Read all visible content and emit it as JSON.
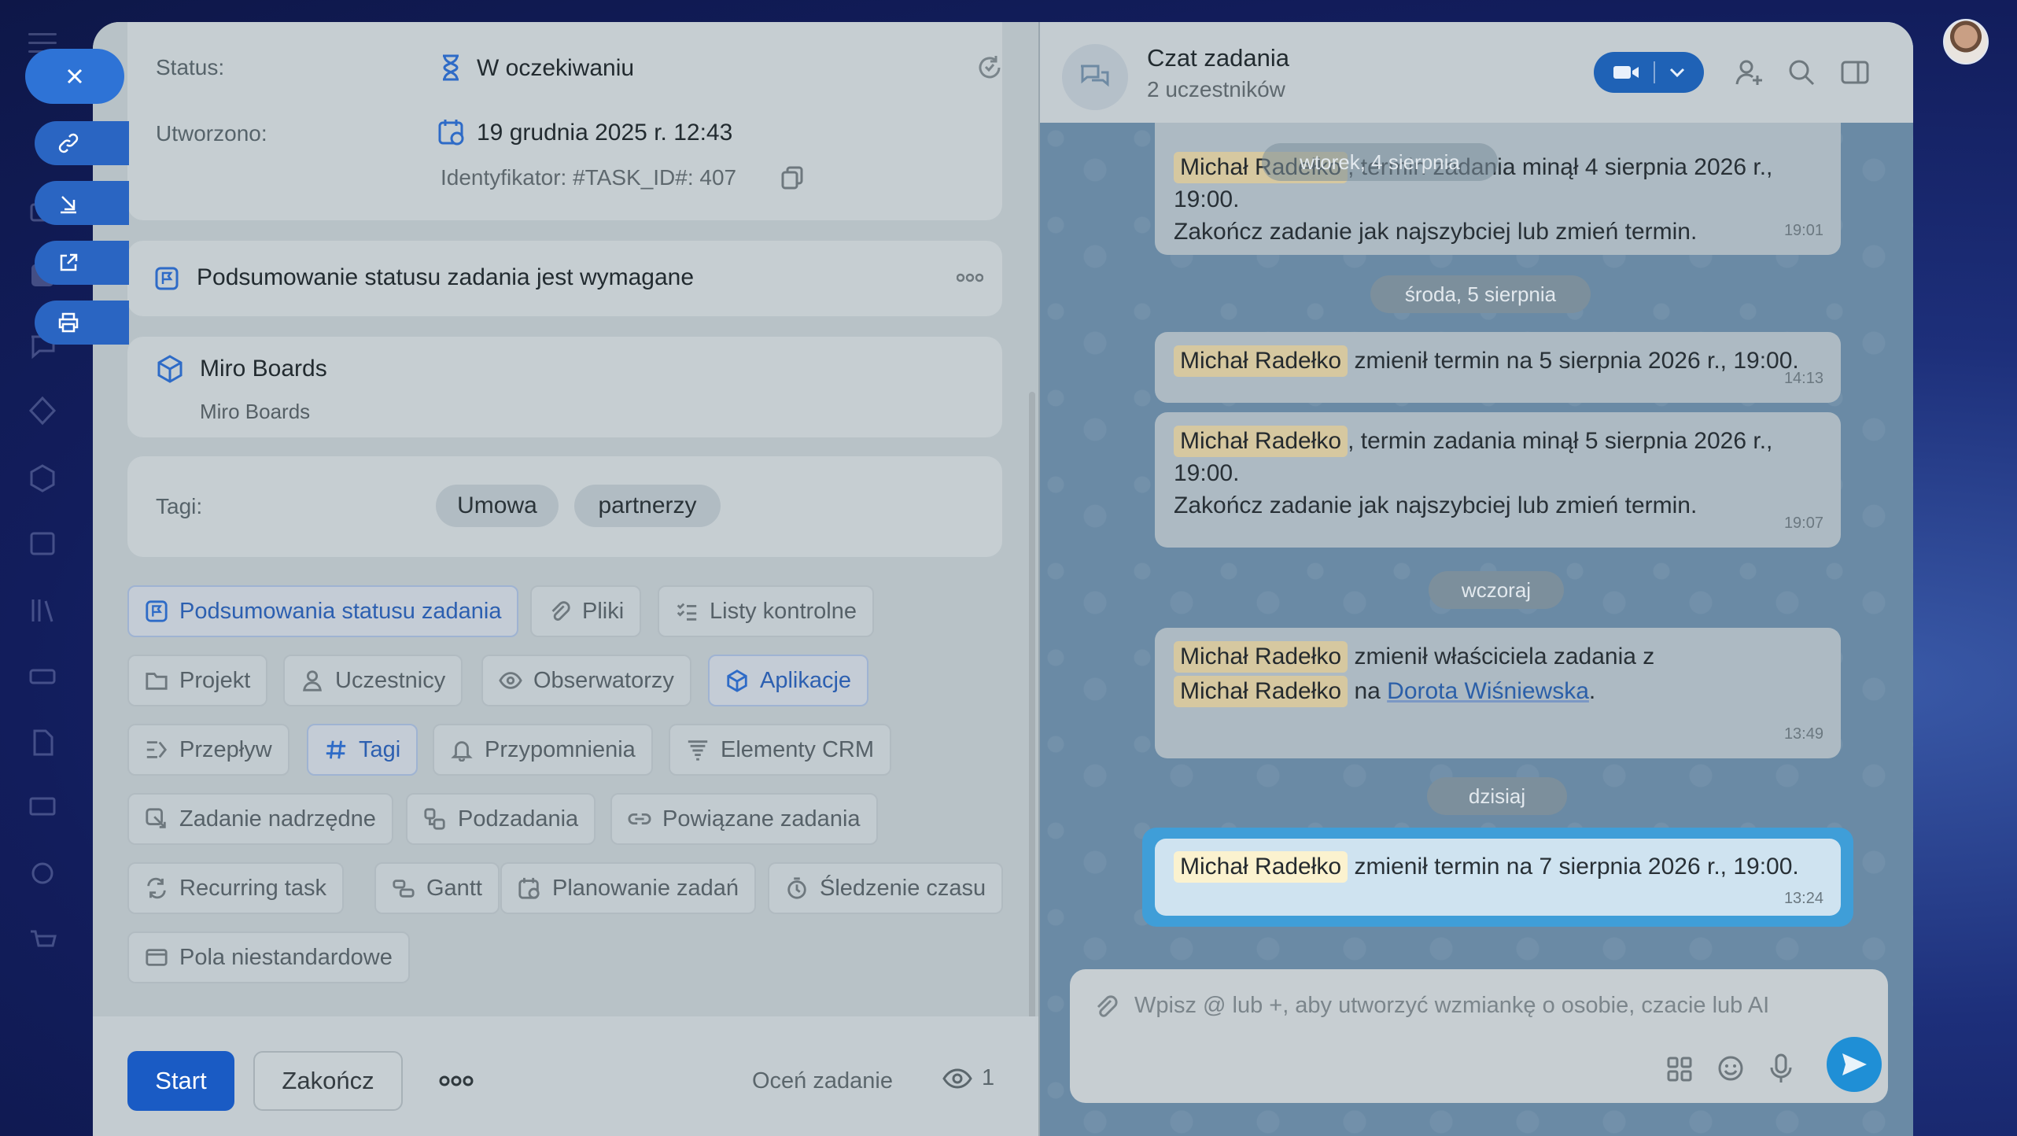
{
  "task": {
    "status_label": "Status:",
    "status_value": "W oczekiwaniu",
    "created_label": "Utworzono:",
    "created_value": "19 grudnia 2025 r. 12:43",
    "identifier": "Identyfikator: #TASK_ID#: 407",
    "summary_notice": "Podsumowanie statusu zadania jest wymagane",
    "app_title": "Miro Boards",
    "app_subtitle": "Miro Boards",
    "tags_label": "Tagi:",
    "tags": [
      "Umowa",
      "partnerzy"
    ]
  },
  "sections": [
    {
      "label": "Podsumowania statusu zadania",
      "icon": "flag-icon",
      "active": true
    },
    {
      "label": "Pliki",
      "icon": "paperclip-icon",
      "active": false
    },
    {
      "label": "Listy kontrolne",
      "icon": "checklist-icon",
      "active": false
    },
    {
      "label": "Projekt",
      "icon": "folder-icon",
      "active": false
    },
    {
      "label": "Uczestnicy",
      "icon": "user-icon",
      "active": false
    },
    {
      "label": "Obserwatorzy",
      "icon": "eye-icon",
      "active": false
    },
    {
      "label": "Aplikacje",
      "icon": "cube-icon",
      "active": true
    },
    {
      "label": "Przepływ",
      "icon": "flow-icon",
      "active": false
    },
    {
      "label": "Tagi",
      "icon": "hash-icon",
      "active": true
    },
    {
      "label": "Przypomnienia",
      "icon": "bell-icon",
      "active": false
    },
    {
      "label": "Elementy CRM",
      "icon": "filter-icon",
      "active": false
    },
    {
      "label": "Zadanie nadrzędne",
      "icon": "parent-task-icon",
      "active": false
    },
    {
      "label": "Podzadania",
      "icon": "subtasks-icon",
      "active": false
    },
    {
      "label": "Powiązane zadania",
      "icon": "link-icon",
      "active": false
    },
    {
      "label": "Recurring task",
      "icon": "repeat-icon",
      "active": false
    },
    {
      "label": "Gantt",
      "icon": "gantt-icon",
      "active": false
    },
    {
      "label": "Planowanie zadań",
      "icon": "calendar-icon",
      "active": false
    },
    {
      "label": "Śledzenie czasu",
      "icon": "timer-icon",
      "active": false
    },
    {
      "label": "Pola niestandardowe",
      "icon": "fields-icon",
      "active": false
    }
  ],
  "footer": {
    "start": "Start",
    "finish": "Zakończ",
    "rate": "Oceń zadanie",
    "watchers_count": "1"
  },
  "chat": {
    "title": "Czat zadania",
    "subtitle": "2 uczestników",
    "messages": [
      {
        "author": "Michał Radełko",
        "text": ", termin zadania minął 4 sierpnia 2026 r., 19:00.",
        "text2": "Zakończ zadanie jak najszybciej lub zmień termin.",
        "time": "19:01",
        "overlay_date": "wtorek, 4 sierpnia"
      },
      {
        "author": "Michał Radełko",
        "text": "zmienił termin na 5 sierpnia 2026 r., 19:00.",
        "time": "14:13"
      },
      {
        "author": "Michał Radełko",
        "text": ", termin zadania minął 5 sierpnia 2026 r., 19:00.",
        "text2": "Zakończ zadanie jak najszybciej lub zmień termin.",
        "time": "19:07"
      },
      {
        "author": "Michał Radełko",
        "text": "zmienił właściciela zadania z",
        "author2": "Michał Radełko",
        "text_na": "na",
        "link": "Dorota Wiśniewska",
        "time": "13:49"
      },
      {
        "author": "Michał Radełko",
        "text": "zmienił termin na 7 sierpnia 2026 r., 19:00.",
        "time": "13:24"
      }
    ],
    "dates": {
      "d1": "środa, 5 sierpnia",
      "d2": "wczoraj",
      "d3": "dzisiaj"
    },
    "composer_placeholder": "Wpisz @ lub +, aby utworzyć wzmiankę o osobie, czacie lub AI"
  },
  "colors": {
    "accent": "#1a5bc4",
    "link": "#2b5fa8",
    "send": "#1f8fd6"
  }
}
